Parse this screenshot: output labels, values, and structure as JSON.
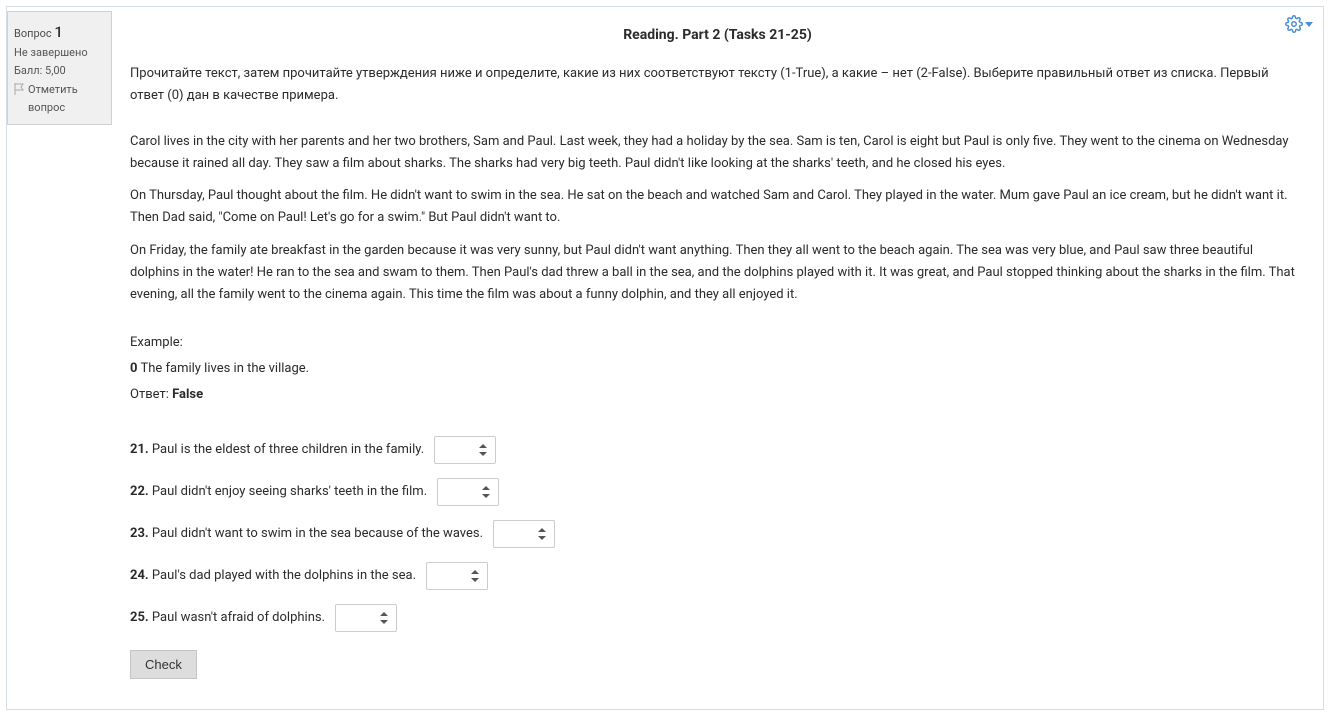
{
  "info": {
    "question_label": "Вопрос",
    "question_number": "1",
    "status": "Не завершено",
    "score": "Балл: 5,00",
    "flag_label": "Отметить вопрос"
  },
  "title": "Reading. Part 2 (Tasks 21-25)",
  "instructions": "Прочитайте текст, затем прочитайте утверждения ниже и определите, какие из них соответствуют тексту  (1-True), а какие – нет  (2-False).  Выберите правильный ответ из списка.  Первый ответ (0) дан в качестве примера.",
  "passage": [
    "Carol lives in the city with her parents and her two brothers, Sam and Paul. Last week, they had a holiday by the sea. Sam is ten, Carol is eight but Paul is only five. They went to the cinema on Wednesday because it rained all day. They saw a film about sharks. The sharks had very big teeth. Paul didn't like looking at the sharks' teeth, and he closed his eyes.",
    "On Thursday, Paul thought about the film. He didn't want to swim in the sea. He sat on the beach and watched Sam and Carol. They played in the water. Mum gave Paul an ice cream, but he didn't want it. Then Dad said, \"Come on Paul! Let's go for a swim.\" But Paul didn't want to.",
    "On Friday, the family ate breakfast in the garden because it was very sunny, but Paul didn't want anything. Then they all went to the beach again. The sea was very blue, and Paul saw three beautiful dolphins in the water! He ran to the sea and swam to them. Then Paul's dad threw a ball in the sea, and the dolphins played with it. It was great, and Paul stopped thinking about the sharks in the film. That evening, all the family went to the cinema again. This time the film was about a funny dolphin, and they all enjoyed it."
  ],
  "example": {
    "label": "Example:",
    "num": "0",
    "text": "The family lives in the village.",
    "answer_label": "Ответ:",
    "answer_value": "False"
  },
  "tasks": [
    {
      "num": "21.",
      "text": "Paul is the eldest of three children in the family."
    },
    {
      "num": "22.",
      "text": "Paul didn't enjoy seeing sharks' teeth in the film."
    },
    {
      "num": "23.",
      "text": "Paul didn't want to swim in the sea because of the waves."
    },
    {
      "num": "24.",
      "text": "Paul's dad played with the dolphins in the sea."
    },
    {
      "num": "25.",
      "text": "Paul wasn't afraid of dolphins."
    }
  ],
  "check_button": "Check"
}
